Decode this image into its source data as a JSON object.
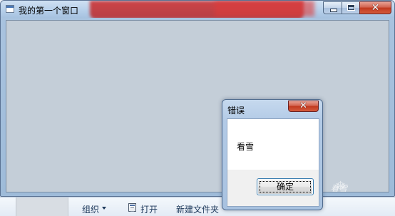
{
  "main_window": {
    "title": "我的第一个窗口"
  },
  "explorer_toolbar": {
    "organize_label": "组织",
    "open_label": "打开",
    "new_folder_label": "新建文件夹"
  },
  "dialog": {
    "title": "错误",
    "message": "看雪",
    "ok_label": "确定"
  },
  "watermark": {
    "text": "看雪"
  },
  "colors": {
    "client_area": "#c4ced8",
    "close_button": "#c1391f",
    "title_glass": "#b7d0ea"
  },
  "icons": {
    "app": "window-app-icon",
    "minimize": "minimize-icon",
    "maximize": "maximize-icon",
    "close": "close-icon",
    "open": "open-document-icon",
    "organize_dropdown": "chevron-down-icon"
  }
}
